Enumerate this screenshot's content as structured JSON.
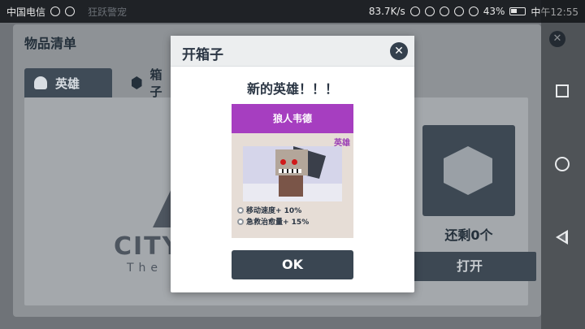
{
  "status_bar": {
    "carrier": "中国电信",
    "notification_title": "狂跃警宠",
    "net_speed": "83.7K/s",
    "battery_pct": "43%",
    "time": "中午12:55"
  },
  "background": {
    "panel_title": "物品清单",
    "close_symbol": "✕",
    "tabs": [
      {
        "label": "英雄",
        "icon": "user-icon",
        "active": true
      },
      {
        "label": "箱子",
        "icon": "box-icon",
        "active": false
      }
    ],
    "logo": {
      "text": "CITY",
      "sub": "The R"
    },
    "remaining": "还剩0个",
    "open_button": "打开"
  },
  "modal": {
    "title": "开箱子",
    "close_symbol": "✕",
    "heading": "新的英雄！！！",
    "card": {
      "name": "狼人韦德",
      "tag": "英雄",
      "stats": [
        "移动速度+ 10%",
        "急救治愈量+ 15%"
      ]
    },
    "ok_label": "OK"
  },
  "colors": {
    "card_purple": "#a63ec0",
    "button_dark": "#3a4652",
    "accent_red": "#d01a1a"
  }
}
